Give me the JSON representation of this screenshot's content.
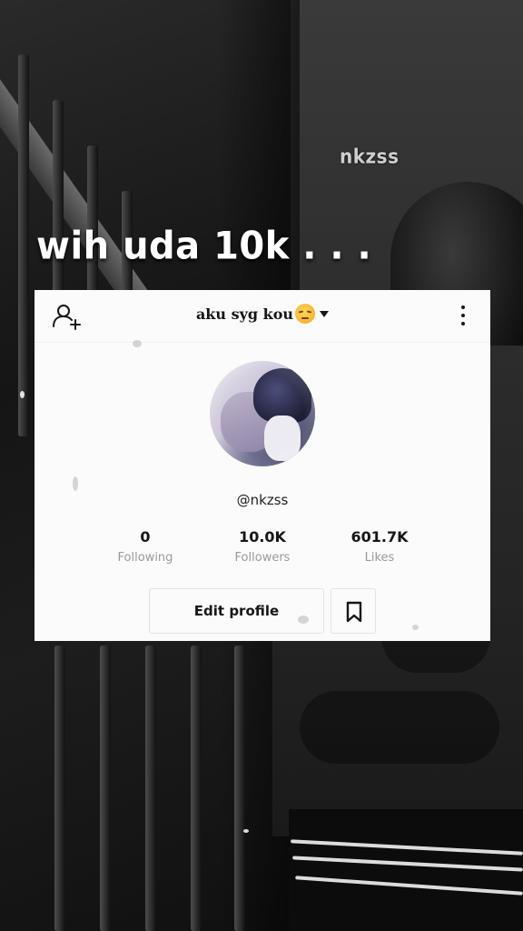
{
  "overlay": {
    "watermark": "nkzss",
    "caption": "wih uda 10k . . ."
  },
  "profile": {
    "name": "aku syg kou",
    "emoji_icon": "pensive-face-emoji",
    "handle": "@nkzss",
    "stats": [
      {
        "value": "0",
        "label": "Following"
      },
      {
        "value": "10.0K",
        "label": "Followers"
      },
      {
        "value": "601.7K",
        "label": "Likes"
      }
    ],
    "edit_label": "Edit profile"
  },
  "icons": {
    "add_user": "add-user-icon",
    "more": "more-vertical-icon",
    "bookmark": "bookmark-icon",
    "dropdown": "chevron-down-icon"
  },
  "colors": {
    "card_bg": "#fbfbfb",
    "text_primary": "#161616",
    "text_secondary": "#9a9a9a"
  }
}
